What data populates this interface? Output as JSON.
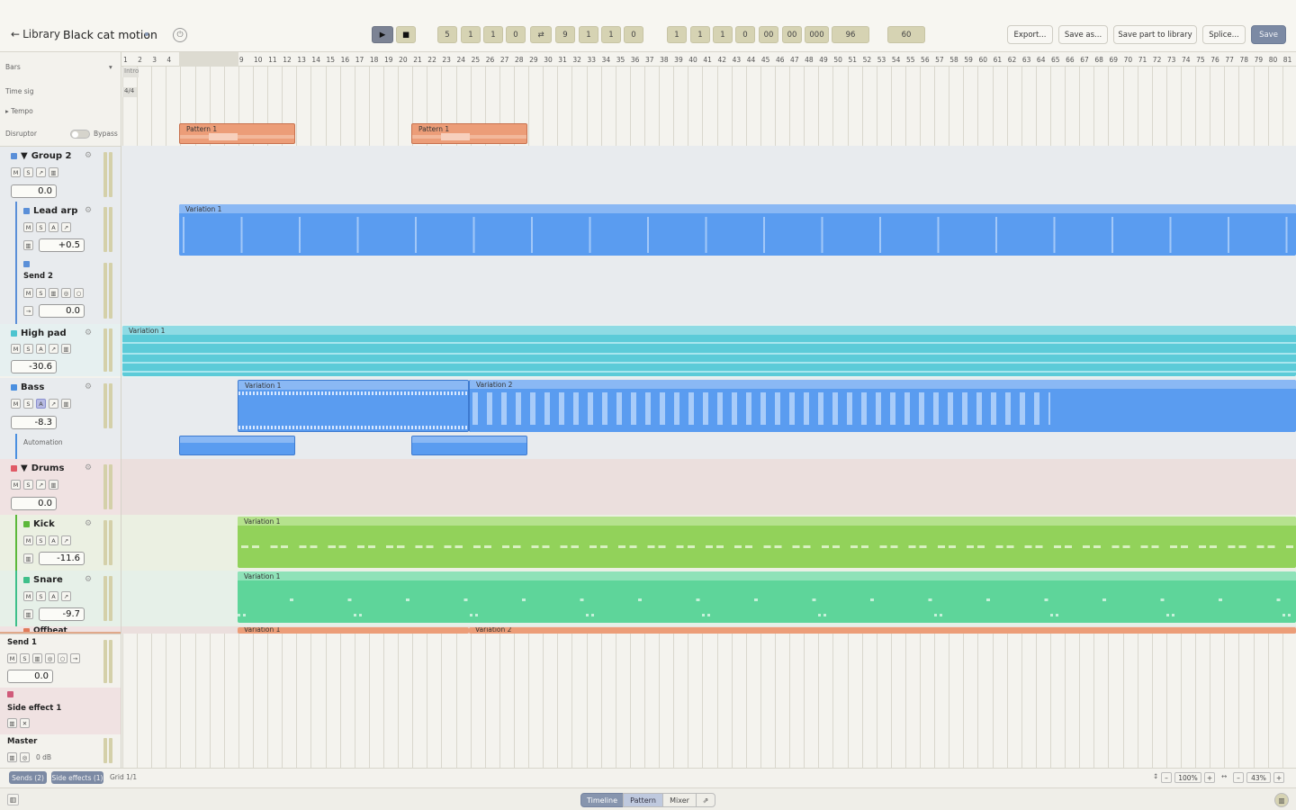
{
  "header": {
    "back_label": "Library",
    "title": "Black cat motion",
    "transport": {
      "position_a": [
        "5",
        "1",
        "1",
        "0"
      ],
      "position_b": [
        "9",
        "1",
        "1",
        "0"
      ],
      "counter": [
        "1",
        "1",
        "1",
        "0",
        "00",
        "00",
        "000"
      ],
      "tempo_value": "96",
      "meter_value": "60"
    },
    "actions": {
      "export": "Export...",
      "save_as": "Save as...",
      "save_part": "Save part to library",
      "splice": "Splice...",
      "save": "Save"
    }
  },
  "lanes": {
    "bars": "Bars",
    "time_sig": "Time sig",
    "time_sig_value": "4/4",
    "tempo": "Tempo",
    "disruptor": "Disruptor",
    "bypass": "Bypass",
    "intro": "Intro"
  },
  "tracks": [
    {
      "name": "Group 2",
      "value": "0.0",
      "color": "#5a8fd8",
      "buttons": [
        "M",
        "S",
        "↗",
        "▥"
      ]
    },
    {
      "name": "Lead arp",
      "value": "+0.5",
      "color": "#5a8fd8",
      "buttons": [
        "M",
        "S",
        "A",
        "↗"
      ]
    },
    {
      "name": "Send 2",
      "value": "0.0",
      "color": "#5a8fd8",
      "buttons": [
        "M",
        "S",
        "▥",
        "◎",
        "○"
      ]
    },
    {
      "name": "High pad",
      "value": "-30.6",
      "color": "#4cc4cf",
      "buttons": [
        "M",
        "S",
        "A",
        "↗",
        "▥"
      ]
    },
    {
      "name": "Bass",
      "value": "-8.3",
      "color": "#4a8fe0",
      "buttons": [
        "M",
        "S",
        "A",
        "↗",
        "▥"
      ]
    },
    {
      "name": "Automation",
      "value": "",
      "color": "#4a8fe0",
      "buttons": []
    },
    {
      "name": "Drums",
      "value": "0.0",
      "color": "#e05a66",
      "buttons": [
        "M",
        "S",
        "↗",
        "▥"
      ]
    },
    {
      "name": "Kick",
      "value": "-11.6",
      "color": "#5cb83a",
      "buttons": [
        "M",
        "S",
        "A",
        "↗"
      ]
    },
    {
      "name": "Snare",
      "value": "-9.7",
      "color": "#3ebf8a",
      "buttons": [
        "M",
        "S",
        "A",
        "↗"
      ]
    },
    {
      "name": "Offbeat",
      "value": "",
      "color": "#e07a5a",
      "buttons": []
    }
  ],
  "sends": {
    "send1": {
      "name": "Send 1",
      "value": "0.0"
    },
    "side_effect": {
      "name": "Side effect 1"
    },
    "master": {
      "name": "Master",
      "value": "0 dB"
    }
  },
  "clips": {
    "pattern1": "Pattern 1",
    "variation1": "Variation 1",
    "variation2": "Variation 2"
  },
  "bottom": {
    "sends_pill": "Sends (2)",
    "side_effects_pill": "Side effects (1)",
    "grid": "Grid 1/1",
    "zoom_v": "100%",
    "zoom_h": "43%"
  },
  "tabs": [
    "Timeline",
    "Pattern",
    "Mixer"
  ],
  "bars": [
    "1",
    "2",
    "3",
    "4",
    "5",
    "6",
    "7",
    "8",
    "9",
    "10",
    "11",
    "12",
    "13",
    "14",
    "15",
    "16",
    "17",
    "18",
    "19",
    "20",
    "21",
    "22",
    "23",
    "24",
    "25",
    "26",
    "27",
    "28",
    "29",
    "30",
    "31",
    "32",
    "33",
    "34",
    "35",
    "36",
    "37",
    "38",
    "39",
    "40",
    "41",
    "42",
    "43",
    "44",
    "45",
    "46",
    "47",
    "48",
    "49",
    "50",
    "51",
    "52",
    "53",
    "54",
    "55",
    "56",
    "57",
    "58",
    "59",
    "60",
    "61",
    "62",
    "63",
    "64",
    "65",
    "66",
    "67",
    "68",
    "69",
    "70",
    "71",
    "72",
    "73",
    "74",
    "75",
    "76",
    "77",
    "78",
    "79",
    "80",
    "81"
  ],
  "colors": {
    "accent": "#7c8aa4",
    "group_blue": "#5a9cf0",
    "pad_cyan": "#5ccbd8",
    "kick_green": "#92d25a",
    "snare_green": "#5ed59a",
    "pattern_orange": "#ec9d78",
    "drums_bg": "#ebdfdd"
  }
}
